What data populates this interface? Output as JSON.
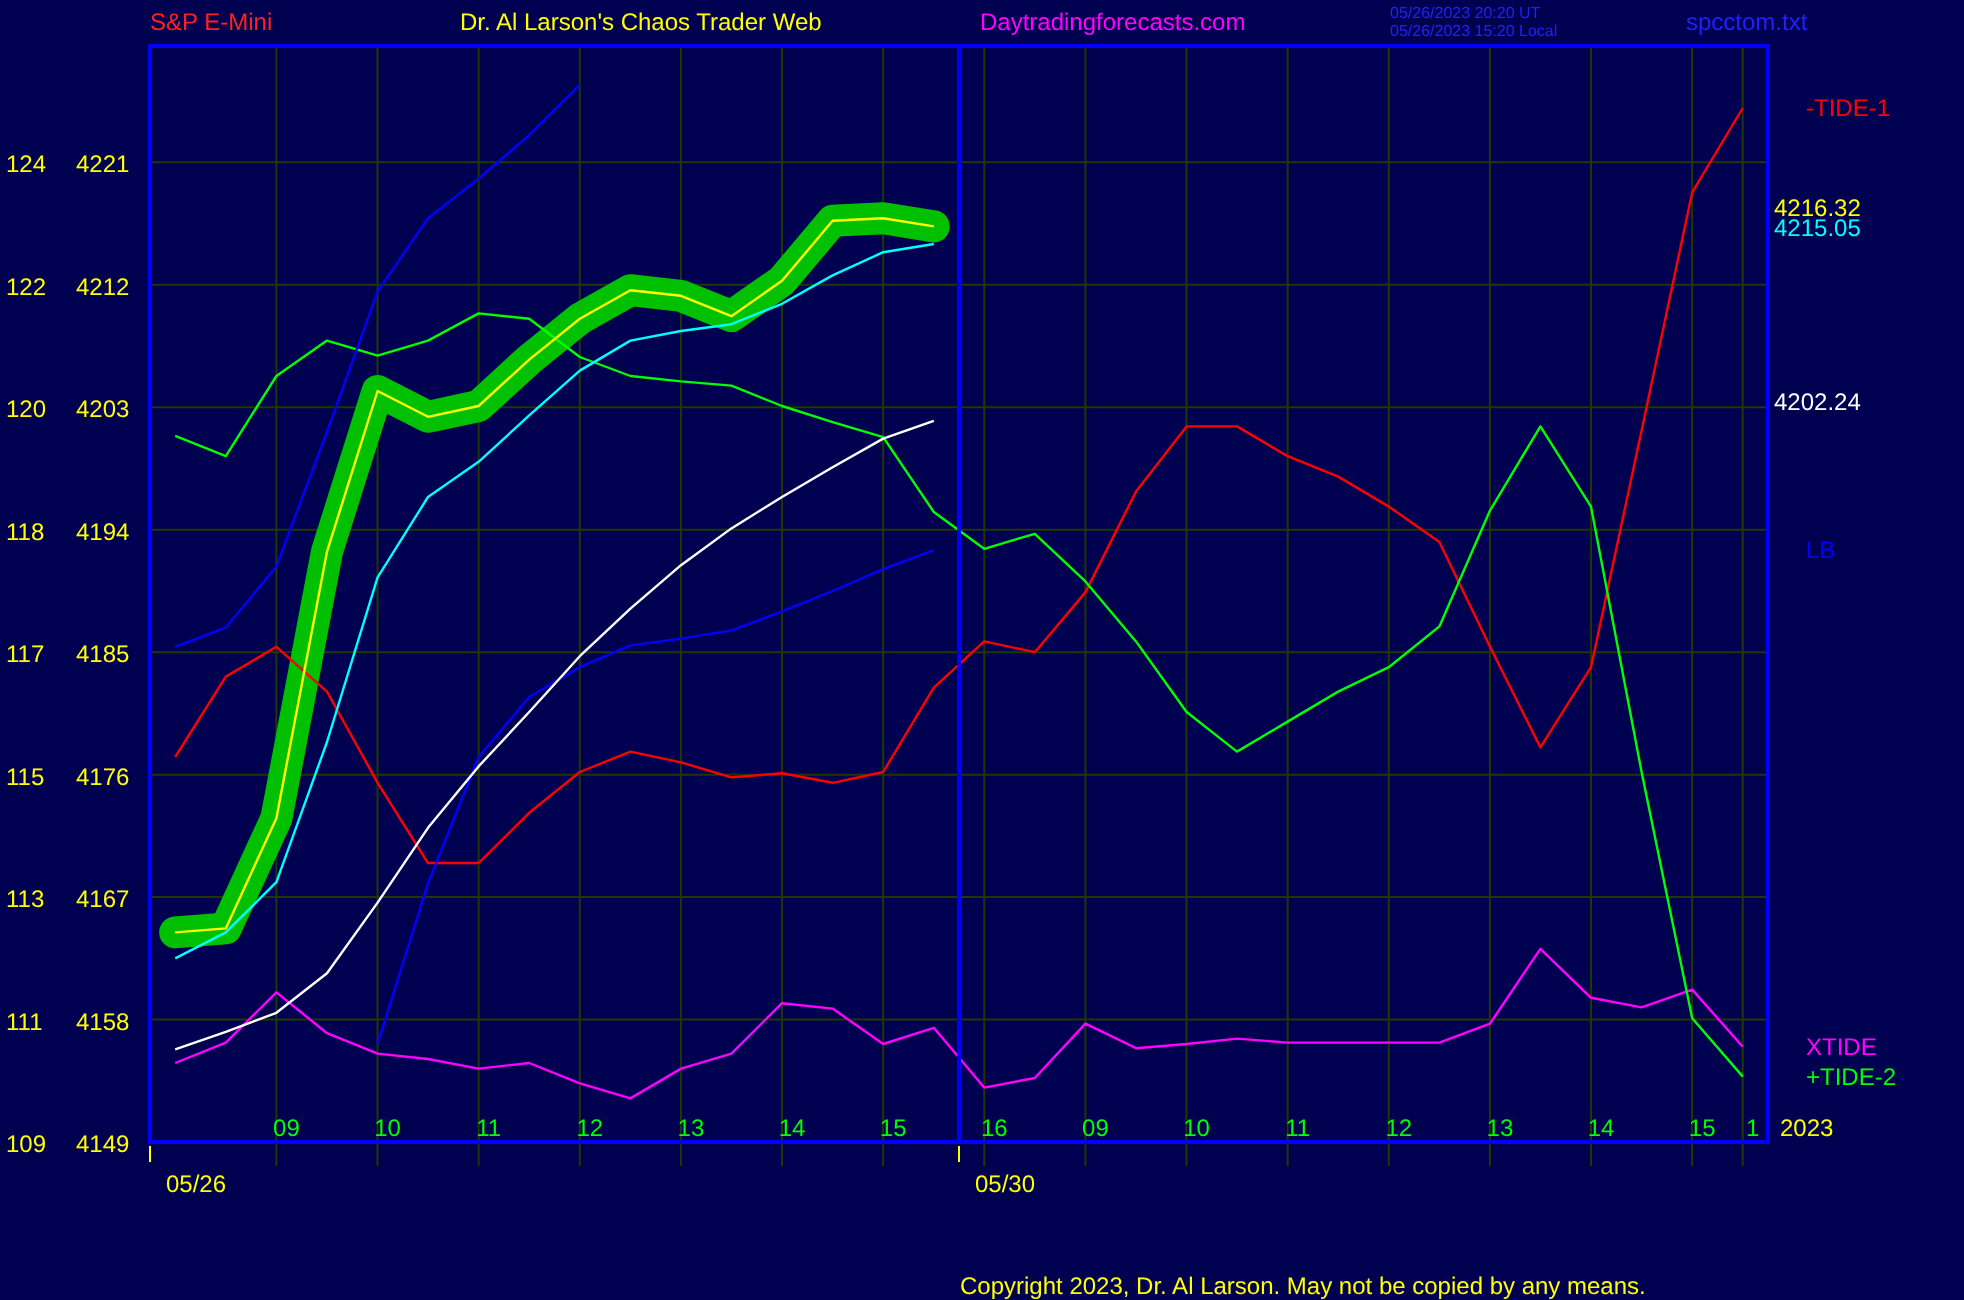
{
  "header": {
    "symbol": "S&P E-Mini",
    "title": "Dr. Al Larson's Chaos Trader Web",
    "website": "Daytradingforecasts.com",
    "timestamps": [
      "05/26/2023 20:20 UT",
      "05/26/2023 15:20 Local"
    ],
    "file": "spcctom.txt"
  },
  "chart": {
    "dates": [
      "05/26",
      "05/30"
    ],
    "left_scale": [
      "124",
      "122",
      "120",
      "118",
      "117",
      "115",
      "113",
      "111",
      "109"
    ],
    "value_labels": [
      {
        "text": "4216.32",
        "color": "#ffff00"
      },
      {
        "text": "4215.05",
        "color": "#00ffff"
      },
      {
        "text": "4202.24",
        "color": "#ffffff"
      }
    ],
    "year": "2023",
    "chart_data": {
      "type": "line",
      "ylim": [
        4149,
        4229.7
      ],
      "grid": true,
      "categories": [
        null,
        null,
        "09",
        null,
        "10",
        null,
        "11",
        null,
        "12",
        null,
        "13",
        null,
        "14",
        null,
        "15",
        null,
        "16",
        null,
        "09",
        null,
        "10",
        null,
        "11",
        null,
        "12",
        null,
        "13",
        null,
        "14",
        null,
        "15",
        "1"
      ],
      "yticks": [
        4221,
        4212,
        4203,
        4194,
        4185,
        4176,
        4167,
        4158,
        4149
      ],
      "series": [
        {
          "name": "XTIDE",
          "color": "#ff00ff",
          "values": [
            4154.8,
            4156.3,
            4160.0,
            4157.0,
            4155.5,
            4155.1,
            4154.4,
            4154.8,
            4153.3,
            4152.2,
            4154.4,
            4155.5,
            4159.2,
            4158.8,
            4156.2,
            4157.4,
            4153.0,
            4153.7,
            4157.7,
            4155.9,
            4156.2,
            4156.6,
            4156.3,
            4156.3,
            4156.3,
            4156.3,
            4157.7,
            4163.2,
            4159.6,
            4158.9,
            4160.2,
            4156.0
          ]
        },
        {
          "name": "-TIDE-1",
          "color": "#ff0000",
          "values": [
            4177.3,
            4183.2,
            4185.4,
            4182.1,
            4175.4,
            4169.5,
            4169.5,
            4173.2,
            4176.2,
            4177.7,
            4176.9,
            4175.8,
            4176.1,
            4175.4,
            4176.2,
            4182.4,
            4185.8,
            4185.0,
            4189.4,
            4196.8,
            4201.6,
            4201.6,
            4199.4,
            4197.9,
            4195.7,
            4193.1,
            4185.4,
            4178.0,
            4183.9,
            4201.3,
            4218.8,
            4225.0
          ]
        },
        {
          "name": "+TIDE-2",
          "color": "#00ff00",
          "values": [
            4200.9,
            4199.4,
            4205.3,
            4207.9,
            4206.8,
            4207.9,
            4209.9,
            4209.5,
            4206.7,
            4205.3,
            4204.9,
            4204.6,
            4203.1,
            4201.9,
            4200.8,
            4195.3,
            4192.6,
            4193.7,
            4190.2,
            4185.8,
            4180.6,
            4177.7,
            4179.9,
            4182.1,
            4183.9,
            4186.9,
            4195.4,
            4201.6,
            4195.7,
            4176.2,
            4158.1,
            4153.8
          ]
        },
        {
          "color": "#0000ff",
          "values": [
            4185.4,
            4186.8,
            4191.3,
            4201.2,
            4211.5,
            4216.9,
            4219.8,
            4223.0,
            4226.7,
            null,
            null,
            null,
            null,
            null,
            null,
            null,
            null,
            null,
            null,
            null,
            null,
            null,
            null,
            null,
            null,
            null,
            null,
            null,
            null,
            null,
            null,
            null
          ]
        },
        {
          "name": "LB",
          "color": "#0000ff",
          "values": [
            null,
            null,
            null,
            null,
            4156.2,
            4168.0,
            4177.3,
            4181.7,
            4183.9,
            4185.5,
            4186.0,
            4186.6,
            4188.0,
            4189.5,
            4191.1,
            4192.5,
            null,
            null,
            null,
            null,
            null,
            null,
            null,
            null,
            null,
            null,
            null,
            null,
            null,
            null,
            null,
            null
          ]
        },
        {
          "color": "#ffffff",
          "values": [
            4155.8,
            4157.1,
            4158.5,
            4161.4,
            4166.6,
            4172.1,
            4176.6,
            4180.6,
            4184.7,
            4188.2,
            4191.4,
            4194.1,
            4196.4,
            4198.6,
            4200.7,
            4202.0,
            null,
            null,
            null,
            null,
            null,
            null,
            null,
            null,
            null,
            null,
            null,
            null,
            null,
            null,
            null,
            null
          ]
        },
        {
          "color": "#00ffff",
          "values": [
            4162.5,
            4164.4,
            4168.1,
            4178.4,
            4190.5,
            4196.4,
            4199.0,
            4202.4,
            4205.7,
            4207.9,
            4208.6,
            4209.1,
            4210.6,
            4212.7,
            4214.4,
            4215.0,
            null,
            null,
            null,
            null,
            null,
            null,
            null,
            null,
            null,
            null,
            null,
            null,
            null,
            null,
            null,
            null
          ]
        },
        {
          "color": "#ffff00",
          "values": [
            4164.4,
            4164.7,
            4172.8,
            4192.4,
            4204.2,
            4202.3,
            4203.1,
            4206.5,
            4209.5,
            4211.6,
            4211.2,
            4209.7,
            4212.3,
            4216.7,
            4216.9,
            4216.3,
            null,
            null,
            null,
            null,
            null,
            null,
            null,
            null,
            null,
            null,
            null,
            null,
            null,
            null,
            null,
            null
          ]
        }
      ]
    }
  },
  "copyright": "Copyright 2023, Dr. Al Larson. May not be copied by any means."
}
